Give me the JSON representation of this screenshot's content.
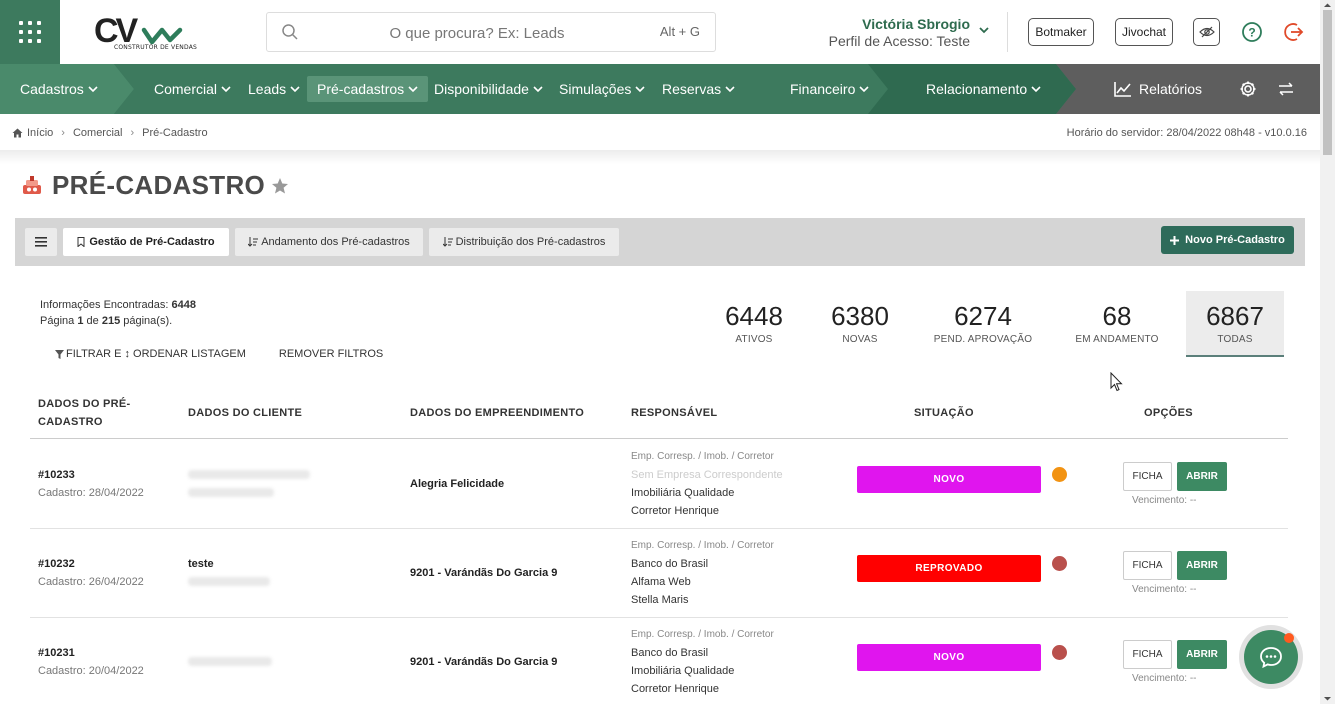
{
  "header": {
    "search_placeholder": "O que procura? Ex: Leads",
    "search_shortcut": "Alt + G",
    "logo_text": "CV",
    "logo_subtitle": "CONSTRUTOR DE VENDAS",
    "user_name": "Victória Sbrogio",
    "user_role": "Perfil de Acesso: Teste",
    "botmaker_label": "Botmaker",
    "jivochat_label": "Jivochat"
  },
  "nav": {
    "items": [
      {
        "label": "Cadastros"
      },
      {
        "label": "Comercial"
      },
      {
        "label": "Leads"
      },
      {
        "label": "Pré-cadastros"
      },
      {
        "label": "Disponibilidade"
      },
      {
        "label": "Simulações"
      },
      {
        "label": "Reservas"
      },
      {
        "label": "Financeiro"
      },
      {
        "label": "Relacionamento"
      }
    ],
    "reports_label": "Relatórios"
  },
  "breadcrumb": {
    "home": "Início",
    "level1": "Comercial",
    "level2": "Pré-Cadastro"
  },
  "server_time": "Horário do servidor: 28/04/2022 08h48 - v10.0.16",
  "page_title": "PRÉ-CADASTRO",
  "toolbar": {
    "tab1": "Gestão de Pré-Cadastro",
    "tab2": "Andamento dos Pré-cadastros",
    "tab3": "Distribuição dos Pré-cadastros",
    "new_button": "Novo Pré-Cadastro"
  },
  "info": {
    "found_label": "Informações Encontradas:",
    "found_count": "6448",
    "page_prefix": "Página",
    "page_current": "1",
    "page_of": "de",
    "page_total": "215",
    "page_suffix": "página(s).",
    "filter_link": "FILTRAR E ↕ ORDENAR LISTAGEM",
    "remove_filters": "REMOVER FILTROS"
  },
  "stats": [
    {
      "value": "6448",
      "label": "ATIVOS"
    },
    {
      "value": "6380",
      "label": "NOVAS"
    },
    {
      "value": "6274",
      "label": "PEND. APROVAÇÃO"
    },
    {
      "value": "68",
      "label": "EM ANDAMENTO"
    },
    {
      "value": "6867",
      "label": "TODAS"
    }
  ],
  "table": {
    "headers": {
      "col1_line1": "DADOS DO PRÉ-",
      "col1_line2": "CADASTRO",
      "col2": "DADOS DO CLIENTE",
      "col3": "DADOS DO EMPREENDIMENTO",
      "col4": "RESPONSÁVEL",
      "col5": "SITUAÇÃO",
      "col6": "OPÇÕES"
    },
    "resp_header": "Emp. Corresp. / Imob. / Corretor",
    "ficha_label": "FICHA",
    "abrir_label": "ABRIR",
    "venc_label": "Vencimento: --",
    "rows": [
      {
        "id": "#10233",
        "date": "Cadastro: 28/04/2022",
        "client": "",
        "project": "Alegria Felicidade",
        "resp1": "Sem Empresa Correspondente",
        "resp2": "Imobiliária Qualidade",
        "resp3": "Corretor Henrique",
        "status": "NOVO",
        "status_color": "#e015ee",
        "dot_color": "#f29313"
      },
      {
        "id": "#10232",
        "date": "Cadastro: 26/04/2022",
        "client": "teste",
        "project": "9201 - Varándãs Do Garcia 9",
        "resp1": "Banco do Brasil",
        "resp2": "Alfama Web",
        "resp3": "Stella Maris",
        "status": "REPROVADO",
        "status_color": "#ff0000",
        "dot_color": "#b9504c"
      },
      {
        "id": "#10231",
        "date": "Cadastro: 20/04/2022",
        "client": "",
        "project": "9201 - Varándãs Do Garcia 9",
        "resp1": "Banco do Brasil",
        "resp2": "Imobiliária Qualidade",
        "resp3": "Corretor Henrique",
        "status": "NOVO",
        "status_color": "#e015ee",
        "dot_color": "#b9504c"
      }
    ]
  },
  "colors": {
    "brand_green": "#3d7a5e",
    "nav_dark": "#5e5e5e",
    "accent_button": "#2e6b5a",
    "open_button": "#3d8a63"
  }
}
